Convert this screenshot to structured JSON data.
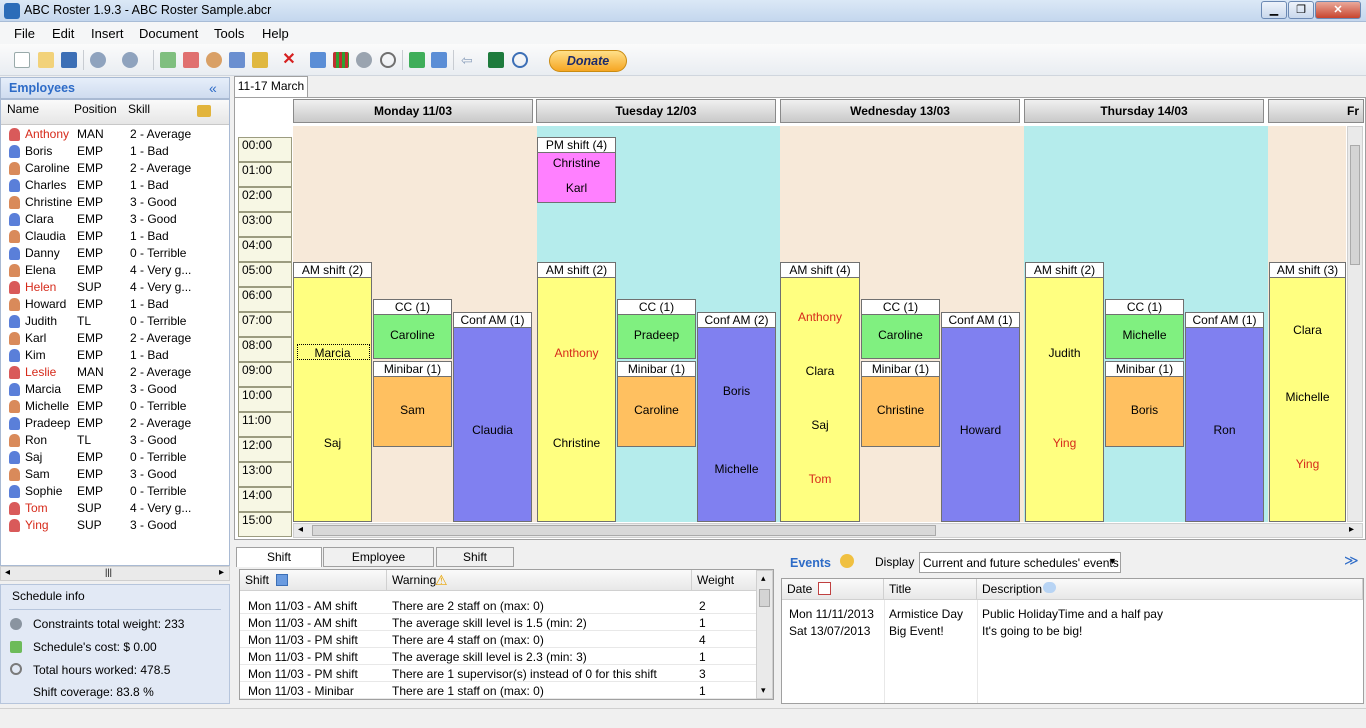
{
  "window": {
    "title": "ABC Roster 1.9.3 - ABC Roster Sample.abcr",
    "minimize": "▁",
    "maximize": "❐",
    "close": "✕"
  },
  "menu": [
    "File",
    "Edit",
    "Insert",
    "Document",
    "Tools",
    "Help"
  ],
  "toolbar": {
    "donate_label": "Donate"
  },
  "employees": {
    "header": "Employees",
    "collapse": "«",
    "columns": [
      "Name",
      "Position",
      "Skill"
    ],
    "rows": [
      {
        "name": "Anthony",
        "position": "MAN",
        "skill": "2 - Average",
        "red": true
      },
      {
        "name": "Boris",
        "position": "EMP",
        "skill": "1 - Bad",
        "red": false
      },
      {
        "name": "Caroline",
        "position": "EMP",
        "skill": "2 - Average",
        "red": false
      },
      {
        "name": "Charles",
        "position": "EMP",
        "skill": "1 - Bad",
        "red": false
      },
      {
        "name": "Christine",
        "position": "EMP",
        "skill": "3 - Good",
        "red": false
      },
      {
        "name": "Clara",
        "position": "EMP",
        "skill": "3 - Good",
        "red": false
      },
      {
        "name": "Claudia",
        "position": "EMP",
        "skill": "1 - Bad",
        "red": false
      },
      {
        "name": "Danny",
        "position": "EMP",
        "skill": "0 - Terrible",
        "red": false
      },
      {
        "name": "Elena",
        "position": "EMP",
        "skill": "4 - Very g...",
        "red": false
      },
      {
        "name": "Helen",
        "position": "SUP",
        "skill": "4 - Very g...",
        "red": true
      },
      {
        "name": "Howard",
        "position": "EMP",
        "skill": "1 - Bad",
        "red": false
      },
      {
        "name": "Judith",
        "position": "TL",
        "skill": "0 - Terrible",
        "red": false
      },
      {
        "name": "Karl",
        "position": "EMP",
        "skill": "2 - Average",
        "red": false
      },
      {
        "name": "Kim",
        "position": "EMP",
        "skill": "1 - Bad",
        "red": false
      },
      {
        "name": "Leslie",
        "position": "MAN",
        "skill": "2 - Average",
        "red": true
      },
      {
        "name": "Marcia",
        "position": "EMP",
        "skill": "3 - Good",
        "red": false
      },
      {
        "name": "Michelle",
        "position": "EMP",
        "skill": "0 - Terrible",
        "red": false
      },
      {
        "name": "Pradeep",
        "position": "EMP",
        "skill": "2 - Average",
        "red": false
      },
      {
        "name": "Ron",
        "position": "TL",
        "skill": "3 - Good",
        "red": false
      },
      {
        "name": "Saj",
        "position": "EMP",
        "skill": "0 - Terrible",
        "red": false
      },
      {
        "name": "Sam",
        "position": "EMP",
        "skill": "3 - Good",
        "red": false
      },
      {
        "name": "Sophie",
        "position": "EMP",
        "skill": "0 - Terrible",
        "red": false
      },
      {
        "name": "Tom",
        "position": "SUP",
        "skill": "4 - Very g...",
        "red": true
      },
      {
        "name": "Ying",
        "position": "SUP",
        "skill": "3 - Good",
        "red": true
      }
    ]
  },
  "schedule_info": {
    "title": "Schedule info",
    "constraints": "Constraints total weight: 233",
    "cost": "Schedule's cost: $ 0.00",
    "hours": "Total hours worked: 478.5",
    "coverage": "Shift coverage: 83.8 %"
  },
  "calendar": {
    "week_tab": "11-17 March",
    "days": [
      "Monday 11/03",
      "Tuesday 12/03",
      "Wednesday 13/03",
      "Thursday 14/03",
      "Fr"
    ],
    "times": [
      "00:00",
      "01:00",
      "02:00",
      "03:00",
      "04:00",
      "05:00",
      "06:00",
      "07:00",
      "08:00",
      "09:00",
      "10:00",
      "11:00",
      "12:00",
      "13:00",
      "14:00",
      "15:00"
    ],
    "shifts": {
      "mon_am": {
        "title": "AM shift (2)",
        "staff": [
          "Marcia",
          "Saj"
        ]
      },
      "mon_cc": {
        "title": "CC (1)",
        "staff": [
          "Caroline"
        ]
      },
      "mon_minibar": {
        "title": "Minibar (1)",
        "staff": [
          "Sam"
        ]
      },
      "mon_conf": {
        "title": "Conf AM (1)",
        "staff": [
          "Claudia"
        ]
      },
      "tue_pm": {
        "title": "PM shift (4)",
        "staff": [
          "Christine",
          "Karl"
        ]
      },
      "tue_am": {
        "title": "AM shift (2)",
        "staff": [
          "Anthony",
          "Christine"
        ]
      },
      "tue_cc": {
        "title": "CC (1)",
        "staff": [
          "Pradeep"
        ]
      },
      "tue_minibar": {
        "title": "Minibar (1)",
        "staff": [
          "Caroline"
        ]
      },
      "tue_conf": {
        "title": "Conf AM (2)",
        "staff": [
          "Boris",
          "Michelle"
        ]
      },
      "wed_am": {
        "title": "AM shift (4)",
        "staff": [
          "Anthony",
          "Clara",
          "Saj",
          "Tom"
        ]
      },
      "wed_cc": {
        "title": "CC (1)",
        "staff": [
          "Caroline"
        ]
      },
      "wed_minibar": {
        "title": "Minibar (1)",
        "staff": [
          "Christine"
        ]
      },
      "wed_conf": {
        "title": "Conf AM (1)",
        "staff": [
          "Howard"
        ]
      },
      "thu_am": {
        "title": "AM shift (2)",
        "staff": [
          "Judith",
          "Ying"
        ]
      },
      "thu_cc": {
        "title": "CC (1)",
        "staff": [
          "Michelle"
        ]
      },
      "thu_minibar": {
        "title": "Minibar (1)",
        "staff": [
          "Boris"
        ]
      },
      "thu_conf": {
        "title": "Conf AM (1)",
        "staff": [
          "Ron"
        ]
      },
      "fri_am": {
        "title": "AM shift (3)",
        "staff": [
          "Clara",
          "Michelle",
          "Ying"
        ]
      }
    }
  },
  "bottom_tabs": [
    "Shift Constraints",
    "Employee Constraints",
    "Shift coverage"
  ],
  "constraints": {
    "columns": [
      "Shift",
      "Warning",
      "Weight"
    ],
    "rows": [
      {
        "shift": "Mon 11/03 - AM shift",
        "warning": "There are 2 staff on (max: 0)",
        "weight": "2"
      },
      {
        "shift": "Mon 11/03 - AM shift",
        "warning": "The average skill level is 1.5 (min: 2)",
        "weight": "1"
      },
      {
        "shift": "Mon 11/03 - PM shift",
        "warning": "There are 4 staff on (max: 0)",
        "weight": "4"
      },
      {
        "shift": "Mon 11/03 - PM shift",
        "warning": "The average skill level is 2.3 (min: 3)",
        "weight": "1"
      },
      {
        "shift": "Mon 11/03 - PM shift",
        "warning": "There are 1 supervisor(s) instead of 0 for this shift",
        "weight": "3"
      },
      {
        "shift": "Mon 11/03 - Minibar",
        "warning": "There are 1 staff on (max: 0)",
        "weight": "1"
      }
    ]
  },
  "events": {
    "title": "Events",
    "display_label": "Display",
    "display_value": "Current and future schedules' events",
    "columns": [
      "Date",
      "Title",
      "Description"
    ],
    "rows": [
      {
        "date": "Mon 11/11/2013",
        "title": "Armistice Day",
        "description": "Public HolidayTime and a half pay"
      },
      {
        "date": "Sat 13/07/2013",
        "title": "Big Event!",
        "description": "It's going to be big!"
      }
    ]
  },
  "colors": {
    "am": "#ffff80",
    "cc": "#80f080",
    "minibar": "#ffc060",
    "conf": "#8080f0",
    "pm": "#ff80ff",
    "day_peach": "#f7e9d9",
    "day_cyan": "#b5ecec",
    "red_text": "#d62a1a",
    "accent": "#2d6bc7"
  }
}
